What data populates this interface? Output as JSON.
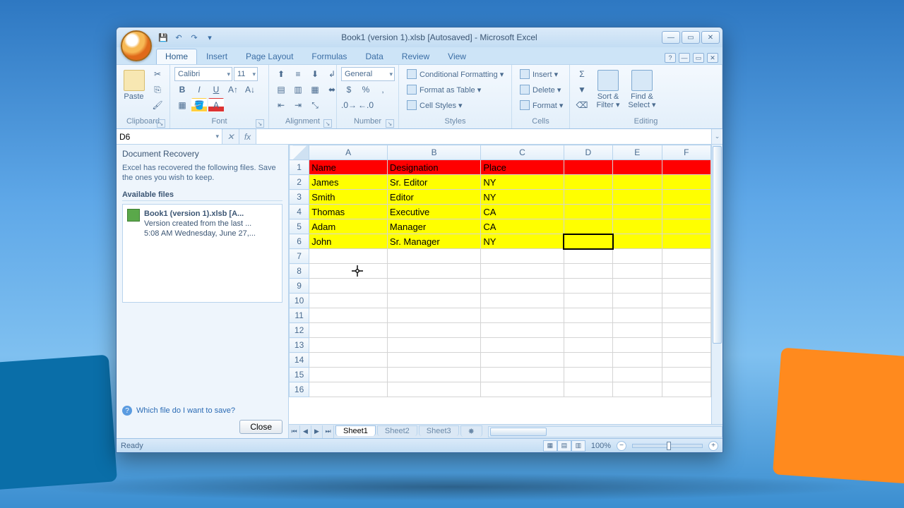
{
  "title": "Book1 (version 1).xlsb [Autosaved] - Microsoft Excel",
  "tabs": [
    "Home",
    "Insert",
    "Page Layout",
    "Formulas",
    "Data",
    "Review",
    "View"
  ],
  "active_tab": "Home",
  "ribbon": {
    "clipboard": {
      "label": "Clipboard",
      "paste": "Paste"
    },
    "font": {
      "label": "Font",
      "name": "Calibri",
      "size": "11"
    },
    "alignment": {
      "label": "Alignment"
    },
    "number": {
      "label": "Number",
      "format": "General"
    },
    "styles": {
      "label": "Styles",
      "cond": "Conditional Formatting ▾",
      "table": "Format as Table ▾",
      "cell": "Cell Styles ▾"
    },
    "cells": {
      "label": "Cells",
      "insert": "Insert ▾",
      "delete": "Delete ▾",
      "format": "Format ▾"
    },
    "editing": {
      "label": "Editing",
      "sort": "Sort & Filter ▾",
      "find": "Find & Select ▾"
    }
  },
  "namebox": "D6",
  "formula": "",
  "recovery": {
    "title": "Document Recovery",
    "explain": "Excel has recovered the following files. Save the ones you wish to keep.",
    "avail": "Available files",
    "file": {
      "name": "Book1 (version 1).xlsb  [A...",
      "line1": "Version created from the last ...",
      "line2": "5:08 AM Wednesday, June 27,..."
    },
    "help_link": "Which file do I want to save?",
    "close": "Close"
  },
  "columns": [
    "A",
    "B",
    "C",
    "D",
    "E",
    "F"
  ],
  "rows": 16,
  "selected_cell": "D6",
  "data": {
    "header": [
      "Name",
      "Designation",
      "Place"
    ],
    "rows": [
      [
        "James",
        "Sr. Editor",
        "NY"
      ],
      [
        "Smith",
        "Editor",
        "NY"
      ],
      [
        "Thomas",
        "Executive",
        "CA"
      ],
      [
        "Adam",
        "Manager",
        "CA"
      ],
      [
        "John",
        "Sr. Manager",
        "NY"
      ]
    ]
  },
  "sheets": [
    "Sheet1",
    "Sheet2",
    "Sheet3"
  ],
  "active_sheet": "Sheet1",
  "status": {
    "ready": "Ready",
    "zoom": "100%"
  }
}
